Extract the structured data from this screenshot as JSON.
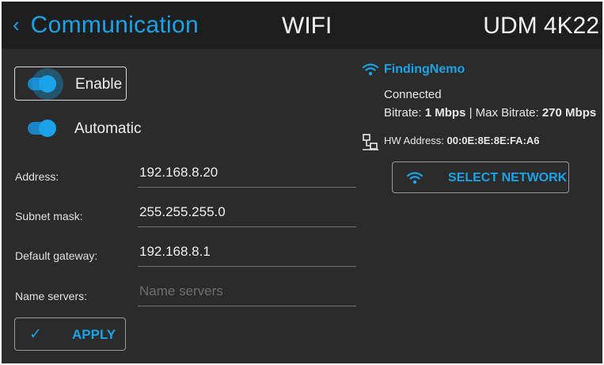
{
  "header": {
    "back_label": "Communication",
    "title": "WIFI",
    "device": "UDM 4K22"
  },
  "toggles": {
    "enable": {
      "label": "Enable",
      "on": true
    },
    "automatic": {
      "label": "Automatic",
      "on": true
    }
  },
  "form": {
    "address": {
      "label": "Address:",
      "value": "192.168.8.20"
    },
    "subnet": {
      "label": "Subnet mask:",
      "value": "255.255.255.0"
    },
    "gateway": {
      "label": "Default gateway:",
      "value": "192.168.8.1"
    },
    "name_servers": {
      "label": "Name servers:",
      "value": "",
      "placeholder": "Name servers"
    }
  },
  "apply": {
    "label": "APPLY"
  },
  "network": {
    "name": "FindingNemo",
    "status": "Connected",
    "bitrate_label": "Bitrate:",
    "bitrate_value": "1 Mbps",
    "separator": "|",
    "max_bitrate_label": "Max Bitrate:",
    "max_bitrate_value": "270 Mbps",
    "hw_label": "HW Address:",
    "hw_value": "00:0E:8E:8E:FA:A6"
  },
  "select_network": {
    "label": "SELECT NETWORK"
  },
  "colors": {
    "accent": "#1aa3e8",
    "background": "#2b2b2b",
    "header": "#1e1e1e"
  },
  "icons": [
    "chevron-left-icon",
    "check-icon",
    "wifi-icon",
    "network-adapter-icon"
  ]
}
